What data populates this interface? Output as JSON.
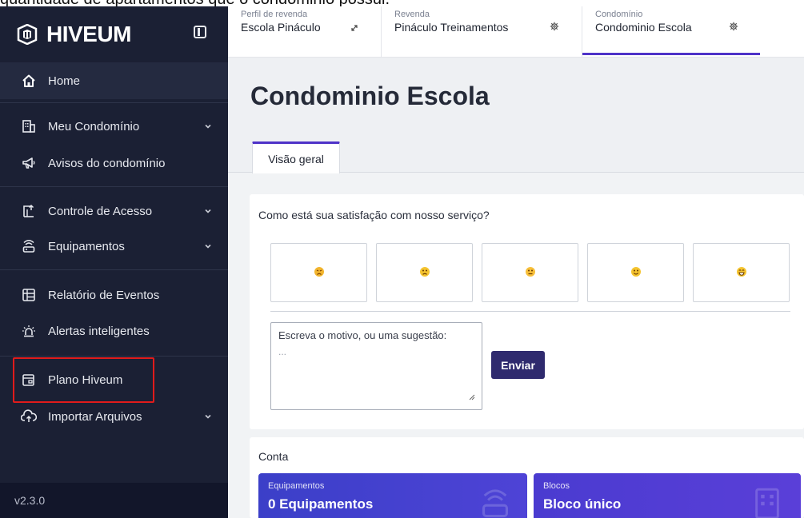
{
  "caption": "quantidade de apartamentos que o condominio possui.",
  "brand": {
    "name": "HIVEUM"
  },
  "sidebar": {
    "items": [
      {
        "label": "Home",
        "icon": "home-icon"
      },
      {
        "label": "Meu Condomínio",
        "icon": "building-icon",
        "expandable": true
      },
      {
        "label": "Avisos do condomínio",
        "icon": "megaphone-icon"
      },
      {
        "label": "Controle de Acesso",
        "icon": "door-access-icon",
        "expandable": true
      },
      {
        "label": "Equipamentos",
        "icon": "router-icon",
        "expandable": true
      },
      {
        "label": "Relatório de Eventos",
        "icon": "report-table-icon"
      },
      {
        "label": "Alertas inteligentes",
        "icon": "alert-light-icon"
      },
      {
        "label": "Plano Hiveum",
        "icon": "plan-icon",
        "highlighted": true
      },
      {
        "label": "Importar Arquivos",
        "icon": "cloud-upload-icon",
        "expandable": true
      }
    ],
    "version": "v2.3.0"
  },
  "topbar": {
    "tabs": [
      {
        "label": "Perfil de revenda",
        "value": "Escola Pináculo",
        "icon": "swap-icon"
      },
      {
        "label": "Revenda",
        "value": "Pináculo Treinamentos",
        "icon": "gear-icon"
      },
      {
        "label": "Condomínio",
        "value": "Condominio Escola",
        "icon": "gear-icon",
        "active": true
      }
    ]
  },
  "page": {
    "title": "Condominio Escola",
    "tabs": [
      {
        "label": "Visão geral",
        "active": true
      }
    ]
  },
  "survey": {
    "question": "Como está sua satisfação com nosso serviço?",
    "options": [
      "very-angry-emoji-icon",
      "sad-emoji-icon",
      "neutral-emoji-icon",
      "happy-emoji-icon",
      "very-happy-emoji-icon"
    ],
    "reason_label": "Escreva o motivo, ou uma sugestão:",
    "reason_placeholder": "...",
    "send_label": "Enviar"
  },
  "account": {
    "title": "Conta",
    "tiles": [
      {
        "label": "Equipamentos",
        "value": "0 Equipamentos",
        "icon": "router-icon"
      },
      {
        "label": "Blocos",
        "value": "Bloco único",
        "icon": "building-icon"
      }
    ]
  },
  "colors": {
    "sidebar_bg": "#1b2034",
    "accent": "#4e32c8",
    "highlight_border": "#e01b1b",
    "send_button": "#2f2a6e"
  }
}
